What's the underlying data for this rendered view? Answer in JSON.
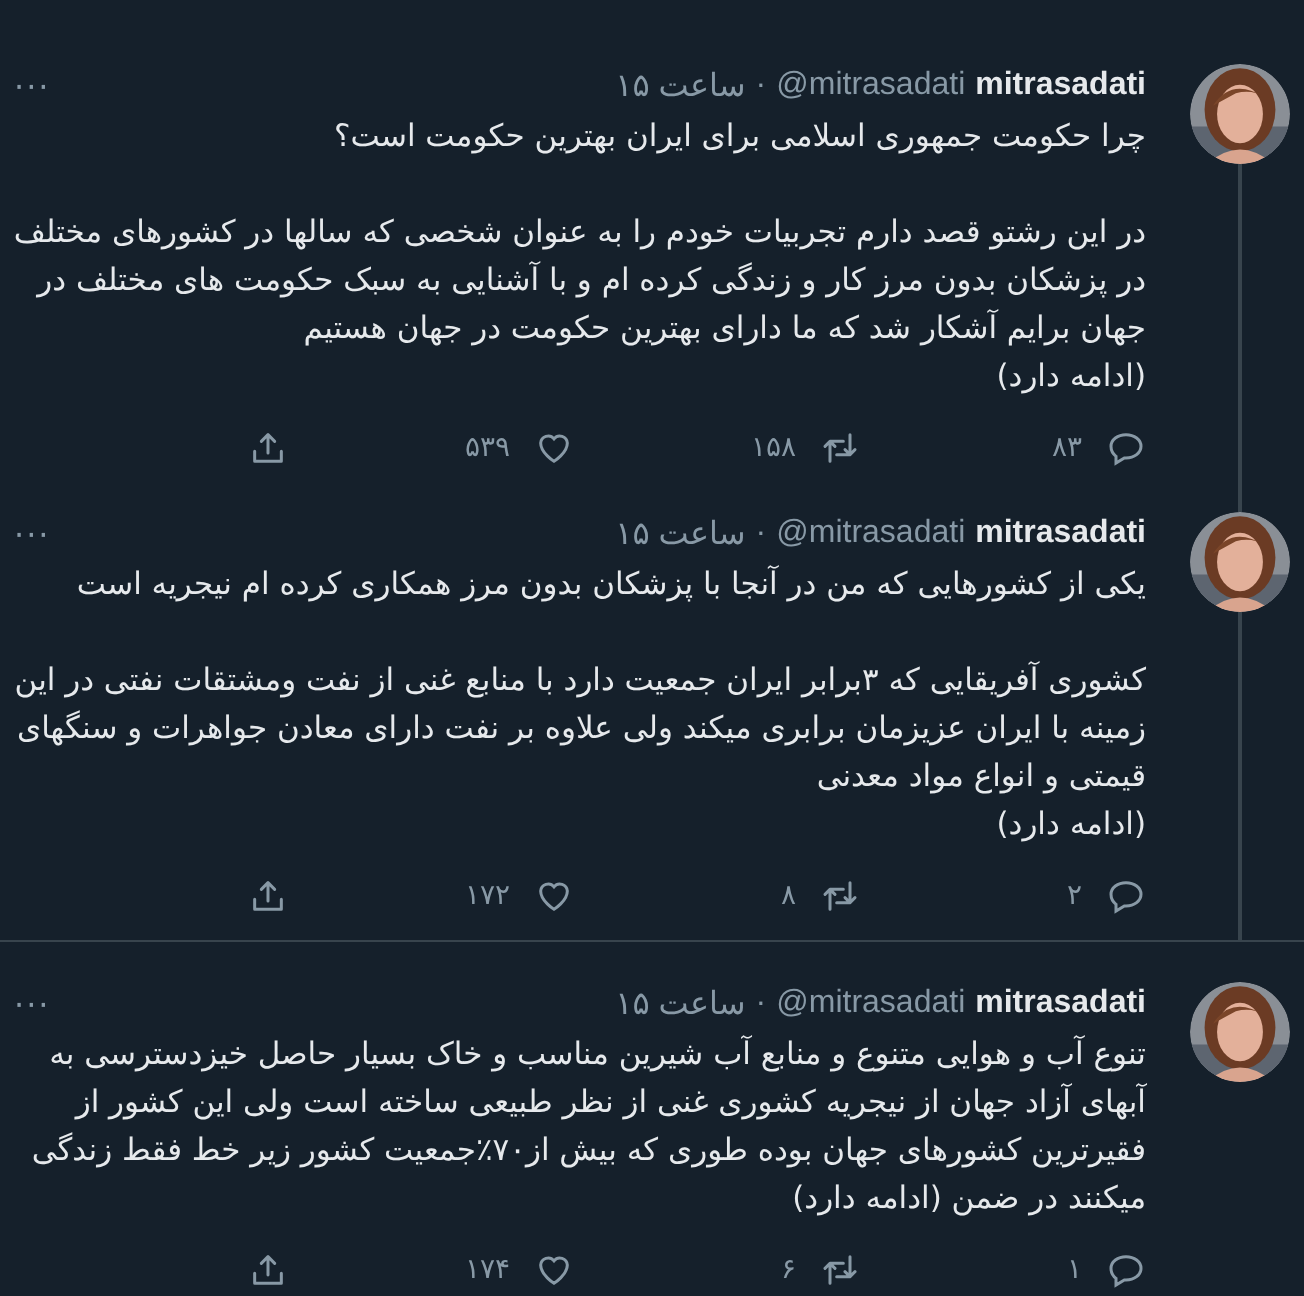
{
  "tweets": [
    {
      "name": "mitrasadati",
      "handle": "@mitrasadati",
      "separator": "·",
      "time": "۱۵ ساعت",
      "menu": "···",
      "thread_above": false,
      "thread_below": true,
      "blocks": [
        [
          "چرا حکومت جمهوری اسلامی برای ایران بهترین حکومت است؟"
        ],
        [
          "در این رشتو قصد دارم تجربیات خودم را به عنوان شخصی که سالها در کشورهای مختلف در پزشکان بدون مرز کار و زندگی  کرده ام و با آشنایی به سبک حکومت های مختلف در جهان برایم آشکار شد که ما دارای بهترین حکومت در جهان هستیم",
          "(ادامه دارد)"
        ]
      ],
      "replies": "۸۳",
      "retweets": "۱۵۸",
      "likes": "۵۳۹"
    },
    {
      "name": "mitrasadati",
      "handle": "@mitrasadati",
      "separator": "·",
      "time": "۱۵ ساعت",
      "menu": "···",
      "thread_above": true,
      "thread_below": true,
      "blocks": [
        [
          "یکی از کشورهایی که من در آنجا با پزشکان بدون مرز همکاری کرده ام نیجریه است"
        ],
        [
          "کشوری آفریقایی که ۳برابر ایران جمعیت دارد با منابع غنی از نفت ومشتقات نفتی در این زمینه با ایران عزیزمان برابری میکند ولی علاوه بر نفت دارای معادن جواهرات و سنگهای قیمتی و انواع مواد معدنی",
          "(ادامه دارد)"
        ]
      ],
      "replies": "۲",
      "retweets": "۸",
      "likes": "۱۷۲"
    },
    {
      "name": "mitrasadati",
      "handle": "@mitrasadati",
      "separator": "·",
      "time": "۱۵ ساعت",
      "menu": "···",
      "thread_above": false,
      "thread_below": false,
      "blocks": [
        [
          "تنوع آب و هوایی متنوع و منابع آب شیرین مناسب و خاک بسیار حاصل خیزدسترسی به آبهای آزاد جهان از نیجریه کشوری غنی از نظر طبیعی ساخته است ولی این کشور از فقیرترین کشورهای جهان بوده طوری که بیش از۷۰٪جمعیت کشور زیر خط فقط زندگی میکنند در ضمن (ادامه دارد)"
        ]
      ],
      "replies": "۱",
      "retweets": "۶",
      "likes": "۱۷۴"
    }
  ]
}
